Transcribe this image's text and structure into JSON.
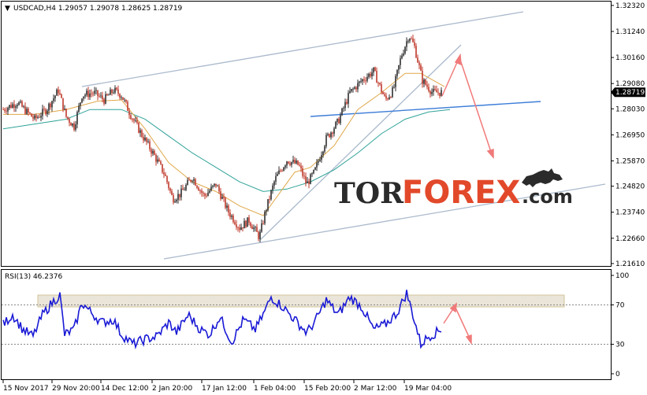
{
  "main_panel": {
    "header": "USDCAD,H4  1.29057  1.29078  1.28625  1.28719",
    "menu_icon": "triangle-down-icon",
    "current_price_label": "1.28719",
    "current_price_color": "#000000"
  },
  "rsi_panel": {
    "header": "RSI(13) 46.2376",
    "levels": [
      "100",
      "70",
      "30",
      "0"
    ]
  },
  "logo": {
    "part1": "TOR",
    "part2": "FOREX",
    "part3": ".com",
    "icon": "bull-icon"
  },
  "colors": {
    "candle_up": "#2f2f2f",
    "candle_down": "#c0392b",
    "ma_fast": "#e0a84a",
    "ma_slow": "#2fa398",
    "channel": "#aab9cc",
    "support": "#3d7dd8",
    "forecast_arrows": "#f07a7a",
    "rsi_line": "#1a1ad6",
    "rsi_zone": "#d2c49a"
  },
  "chart_data": [
    {
      "type": "candlestick",
      "symbol": "USDCAD",
      "timeframe": "H4",
      "ohlc_last": {
        "open": 1.29057,
        "high": 1.29078,
        "low": 1.28625,
        "close": 1.28719
      },
      "y_ticks": [
        1.3232,
        1.3124,
        1.3016,
        1.2908,
        1.2803,
        1.2695,
        1.2587,
        1.2482,
        1.2374,
        1.2266,
        1.2161
      ],
      "y_tick_labels": [
        "1.32320",
        "1.31240",
        "1.30160",
        "1.29080",
        "1.28030",
        "1.26950",
        "1.25870",
        "1.24820",
        "1.23740",
        "1.22660",
        "1.21610"
      ],
      "ylim": [
        1.2151,
        1.3248
      ],
      "x_tick_labels": [
        "15 Nov 2017",
        "29 Nov 20:00",
        "14 Dec 12:00",
        "2 Jan 20:00",
        "17 Jan 12:00",
        "1 Feb 04:00",
        "15 Feb 20:00",
        "2 Mar 12:00",
        "19 Mar 04:00"
      ],
      "close_path": [
        [
          0,
          1.28
        ],
        [
          18,
          1.283
        ],
        [
          30,
          1.279
        ],
        [
          40,
          1.276
        ],
        [
          55,
          1.28
        ],
        [
          70,
          1.288
        ],
        [
          80,
          1.277
        ],
        [
          90,
          1.273
        ],
        [
          100,
          1.286
        ],
        [
          115,
          1.287
        ],
        [
          128,
          1.284
        ],
        [
          140,
          1.288
        ],
        [
          150,
          1.286
        ],
        [
          160,
          1.279
        ],
        [
          175,
          1.27
        ],
        [
          190,
          1.262
        ],
        [
          205,
          1.253
        ],
        [
          215,
          1.243
        ],
        [
          225,
          1.245
        ],
        [
          240,
          1.252
        ],
        [
          255,
          1.244
        ],
        [
          270,
          1.249
        ],
        [
          285,
          1.238
        ],
        [
          300,
          1.231
        ],
        [
          312,
          1.234
        ],
        [
          325,
          1.227
        ],
        [
          333,
          1.238
        ],
        [
          345,
          1.251
        ],
        [
          360,
          1.259
        ],
        [
          375,
          1.257
        ],
        [
          385,
          1.249
        ],
        [
          395,
          1.254
        ],
        [
          410,
          1.268
        ],
        [
          425,
          1.275
        ],
        [
          440,
          1.287
        ],
        [
          455,
          1.292
        ],
        [
          470,
          1.296
        ],
        [
          485,
          1.284
        ],
        [
          495,
          1.288
        ],
        [
          505,
          1.302
        ],
        [
          515,
          1.311
        ],
        [
          522,
          1.306
        ],
        [
          532,
          1.292
        ],
        [
          545,
          1.287
        ],
        [
          557,
          1.2872
        ]
      ],
      "ma_fast": [
        [
          0,
          1.278
        ],
        [
          40,
          1.278
        ],
        [
          80,
          1.28
        ],
        [
          120,
          1.2835
        ],
        [
          150,
          1.284
        ],
        [
          180,
          1.272
        ],
        [
          210,
          1.258
        ],
        [
          240,
          1.25
        ],
        [
          270,
          1.246
        ],
        [
          300,
          1.24
        ],
        [
          330,
          1.236
        ],
        [
          350,
          1.245
        ],
        [
          370,
          1.254
        ],
        [
          390,
          1.256
        ],
        [
          420,
          1.265
        ],
        [
          450,
          1.28
        ],
        [
          480,
          1.287
        ],
        [
          510,
          1.295
        ],
        [
          530,
          1.295
        ],
        [
          560,
          1.2895
        ]
      ],
      "ma_slow": [
        [
          0,
          1.272
        ],
        [
          40,
          1.274
        ],
        [
          80,
          1.276
        ],
        [
          110,
          1.28
        ],
        [
          150,
          1.28
        ],
        [
          180,
          1.276
        ],
        [
          210,
          1.269
        ],
        [
          240,
          1.262
        ],
        [
          270,
          1.256
        ],
        [
          300,
          1.25
        ],
        [
          330,
          1.246
        ],
        [
          360,
          1.247
        ],
        [
          390,
          1.25
        ],
        [
          420,
          1.255
        ],
        [
          450,
          1.262
        ],
        [
          480,
          1.27
        ],
        [
          510,
          1.276
        ],
        [
          540,
          1.279
        ],
        [
          567,
          1.28
        ]
      ]
    },
    {
      "type": "line",
      "name": "RSI(13)",
      "last_value": 46.2376,
      "ylim": [
        0,
        100
      ],
      "y_ticks": [
        100,
        70,
        30,
        0
      ],
      "levels": [
        70,
        30
      ],
      "highlight_zone": [
        68,
        80
      ],
      "values": [
        [
          0,
          50
        ],
        [
          12,
          60
        ],
        [
          25,
          45
        ],
        [
          38,
          38
        ],
        [
          50,
          60
        ],
        [
          62,
          72
        ],
        [
          72,
          80
        ],
        [
          78,
          40
        ],
        [
          90,
          45
        ],
        [
          100,
          72
        ],
        [
          112,
          62
        ],
        [
          125,
          52
        ],
        [
          140,
          55
        ],
        [
          150,
          40
        ],
        [
          165,
          30
        ],
        [
          180,
          35
        ],
        [
          195,
          38
        ],
        [
          210,
          52
        ],
        [
          220,
          42
        ],
        [
          235,
          60
        ],
        [
          250,
          45
        ],
        [
          262,
          40
        ],
        [
          275,
          58
        ],
        [
          290,
          32
        ],
        [
          305,
          55
        ],
        [
          320,
          45
        ],
        [
          330,
          60
        ],
        [
          340,
          78
        ],
        [
          355,
          68
        ],
        [
          370,
          55
        ],
        [
          385,
          42
        ],
        [
          395,
          52
        ],
        [
          410,
          75
        ],
        [
          425,
          60
        ],
        [
          440,
          78
        ],
        [
          455,
          68
        ],
        [
          470,
          45
        ],
        [
          485,
          50
        ],
        [
          500,
          62
        ],
        [
          512,
          82
        ],
        [
          520,
          60
        ],
        [
          530,
          30
        ],
        [
          540,
          38
        ],
        [
          550,
          42
        ],
        [
          557,
          46
        ]
      ]
    }
  ]
}
